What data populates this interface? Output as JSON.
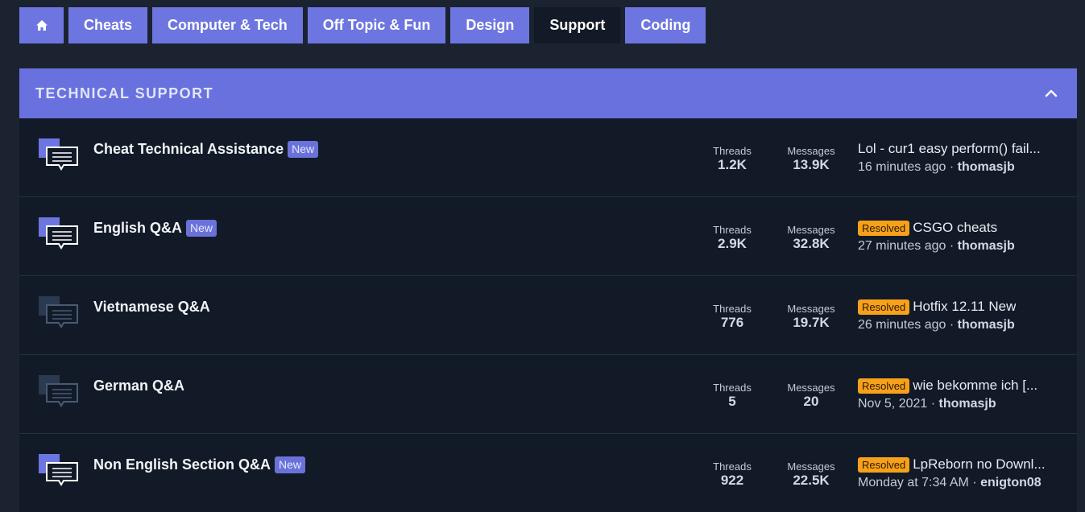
{
  "nav": {
    "home_icon": "home-icon",
    "tabs": [
      {
        "label": "Cheats"
      },
      {
        "label": "Computer & Tech"
      },
      {
        "label": "Off Topic & Fun"
      },
      {
        "label": "Design"
      },
      {
        "label": "Support",
        "active": true
      },
      {
        "label": "Coding"
      }
    ]
  },
  "section": {
    "title": "TECHNICAL SUPPORT",
    "collapse_icon": "chevron-up-icon"
  },
  "labels": {
    "threads": "Threads",
    "messages": "Messages",
    "new_badge": "New",
    "resolved_badge": "Resolved",
    "separator": "·"
  },
  "forums": [
    {
      "title": "Cheat Technical Assistance",
      "new": true,
      "unread": true,
      "threads": "1.2K",
      "messages": "13.9K",
      "latest_title": "Lol - cur1 easy perform() fail...",
      "resolved": false,
      "latest_time": "16 minutes ago",
      "latest_user": "thomasjb"
    },
    {
      "title": "English Q&A",
      "new": true,
      "unread": true,
      "threads": "2.9K",
      "messages": "32.8K",
      "latest_title": "CSGO cheats",
      "resolved": true,
      "latest_time": "27 minutes ago",
      "latest_user": "thomasjb"
    },
    {
      "title": "Vietnamese Q&A",
      "new": false,
      "unread": false,
      "threads": "776",
      "messages": "19.7K",
      "latest_title": "Hotfix 12.11 New",
      "resolved": true,
      "latest_time": "26 minutes ago",
      "latest_user": "thomasjb"
    },
    {
      "title": "German Q&A",
      "new": false,
      "unread": false,
      "threads": "5",
      "messages": "20",
      "latest_title": "wie bekomme ich [...",
      "resolved": true,
      "latest_time": "Nov 5, 2021",
      "latest_user": "thomasjb"
    },
    {
      "title": "Non English Section Q&A",
      "new": true,
      "unread": true,
      "threads": "922",
      "messages": "22.5K",
      "latest_title": "LpReborn no Downl...",
      "resolved": true,
      "latest_time": "Monday at 7:34 AM",
      "latest_user": "enigton08"
    }
  ],
  "colors": {
    "accent": "#6d76e0",
    "icon_read": "#2a3a50",
    "resolved": "#f7a11a"
  }
}
